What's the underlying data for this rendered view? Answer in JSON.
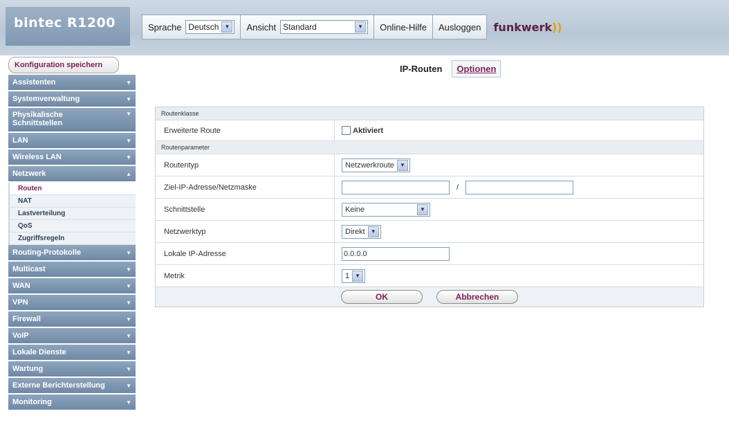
{
  "brand": {
    "name": "bintec R1200"
  },
  "topnav": {
    "language_label": "Sprache",
    "language_value": "Deutsch",
    "view_label": "Ansicht",
    "view_value": "Standard",
    "help": "Online-Hilfe",
    "logout": "Ausloggen",
    "logo": "funkwerk"
  },
  "sidebar": {
    "save": "Konfiguration speichern",
    "items": [
      {
        "label": "Assistenten"
      },
      {
        "label": "Systemverwaltung"
      },
      {
        "label": "Physikalische Schnittstellen"
      },
      {
        "label": "LAN"
      },
      {
        "label": "Wireless LAN"
      },
      {
        "label": "Netzwerk"
      },
      {
        "label": "Routing-Protokolle"
      },
      {
        "label": "Multicast"
      },
      {
        "label": "WAN"
      },
      {
        "label": "VPN"
      },
      {
        "label": "Firewall"
      },
      {
        "label": "VoIP"
      },
      {
        "label": "Lokale Dienste"
      },
      {
        "label": "Wartung"
      },
      {
        "label": "Externe Berichterstellung"
      },
      {
        "label": "Monitoring"
      }
    ],
    "netzwerk_sub": [
      {
        "label": "Routen"
      },
      {
        "label": "NAT"
      },
      {
        "label": "Lastverteilung"
      },
      {
        "label": "QoS"
      },
      {
        "label": "Zugriffsregeln"
      }
    ]
  },
  "tabs": {
    "active": "IP-Routen",
    "other": "Optionen"
  },
  "form": {
    "section1": "Routenklasse",
    "erweiterte_label": "Erweiterte Route",
    "erweiterte_cb_label": "Aktiviert",
    "section2": "Routenparameter",
    "routentyp_label": "Routentyp",
    "routentyp_value": "Netzwerkroute",
    "ziel_label": "Ziel-IP-Adresse/Netzmaske",
    "ziel_ip": "",
    "ziel_mask": "",
    "slash": "/",
    "schnitt_label": "Schnittstelle",
    "schnitt_value": "Keine",
    "netztyp_label": "Netzwerktyp",
    "netztyp_value": "Direkt",
    "lokale_label": "Lokale IP-Adresse",
    "lokale_value": "0.0.0.0",
    "metrik_label": "Metrik",
    "metrik_value": "1",
    "ok": "OK",
    "cancel": "Abbrechen"
  },
  "colors": {
    "accent": "#7a1f54",
    "menu": "#7f98b2"
  }
}
